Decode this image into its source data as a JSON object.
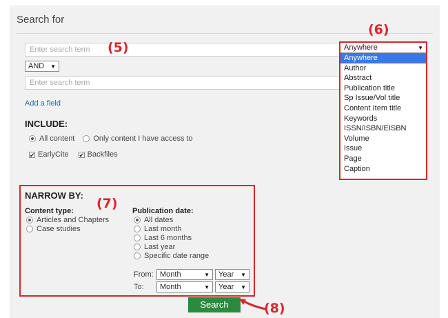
{
  "header": {
    "title": "Search for"
  },
  "annotations": {
    "a5": "(5)",
    "a6": "(6)",
    "a7": "(7)",
    "a8": "(8)"
  },
  "search": {
    "term1_placeholder": "Enter search term",
    "term2_placeholder": "Enter search term",
    "operator": "AND",
    "add_field": "Add a field"
  },
  "field_dropdown": {
    "selected": "Anywhere",
    "options": [
      "Anywhere",
      "Author",
      "Abstract",
      "Publication title",
      "Sp Issue/Vol title",
      "Content Item title",
      "Keywords",
      "ISSN/ISBN/EISBN",
      "Volume",
      "Issue",
      "Page",
      "Caption"
    ]
  },
  "include": {
    "heading": "INCLUDE:",
    "all_content": "All content",
    "only_access": "Only content I have access to",
    "earlycite": "EarlyCite",
    "backfiles": "Backfiles"
  },
  "narrow": {
    "heading": "NARROW BY:",
    "content_type_label": "Content type:",
    "content_types": [
      "Articles and Chapters",
      "Case studies"
    ],
    "pub_date_label": "Publication date:",
    "pub_dates": [
      "All dates",
      "Last month",
      "Last 6 months",
      "Last year",
      "Specific date range"
    ],
    "from_label": "From:",
    "to_label": "To:",
    "month": "Month",
    "year": "Year"
  },
  "actions": {
    "search_label": "Search"
  },
  "colors": {
    "annotation": "#d9262e",
    "search_button": "#2b8a3e",
    "link": "#2e6da4"
  }
}
